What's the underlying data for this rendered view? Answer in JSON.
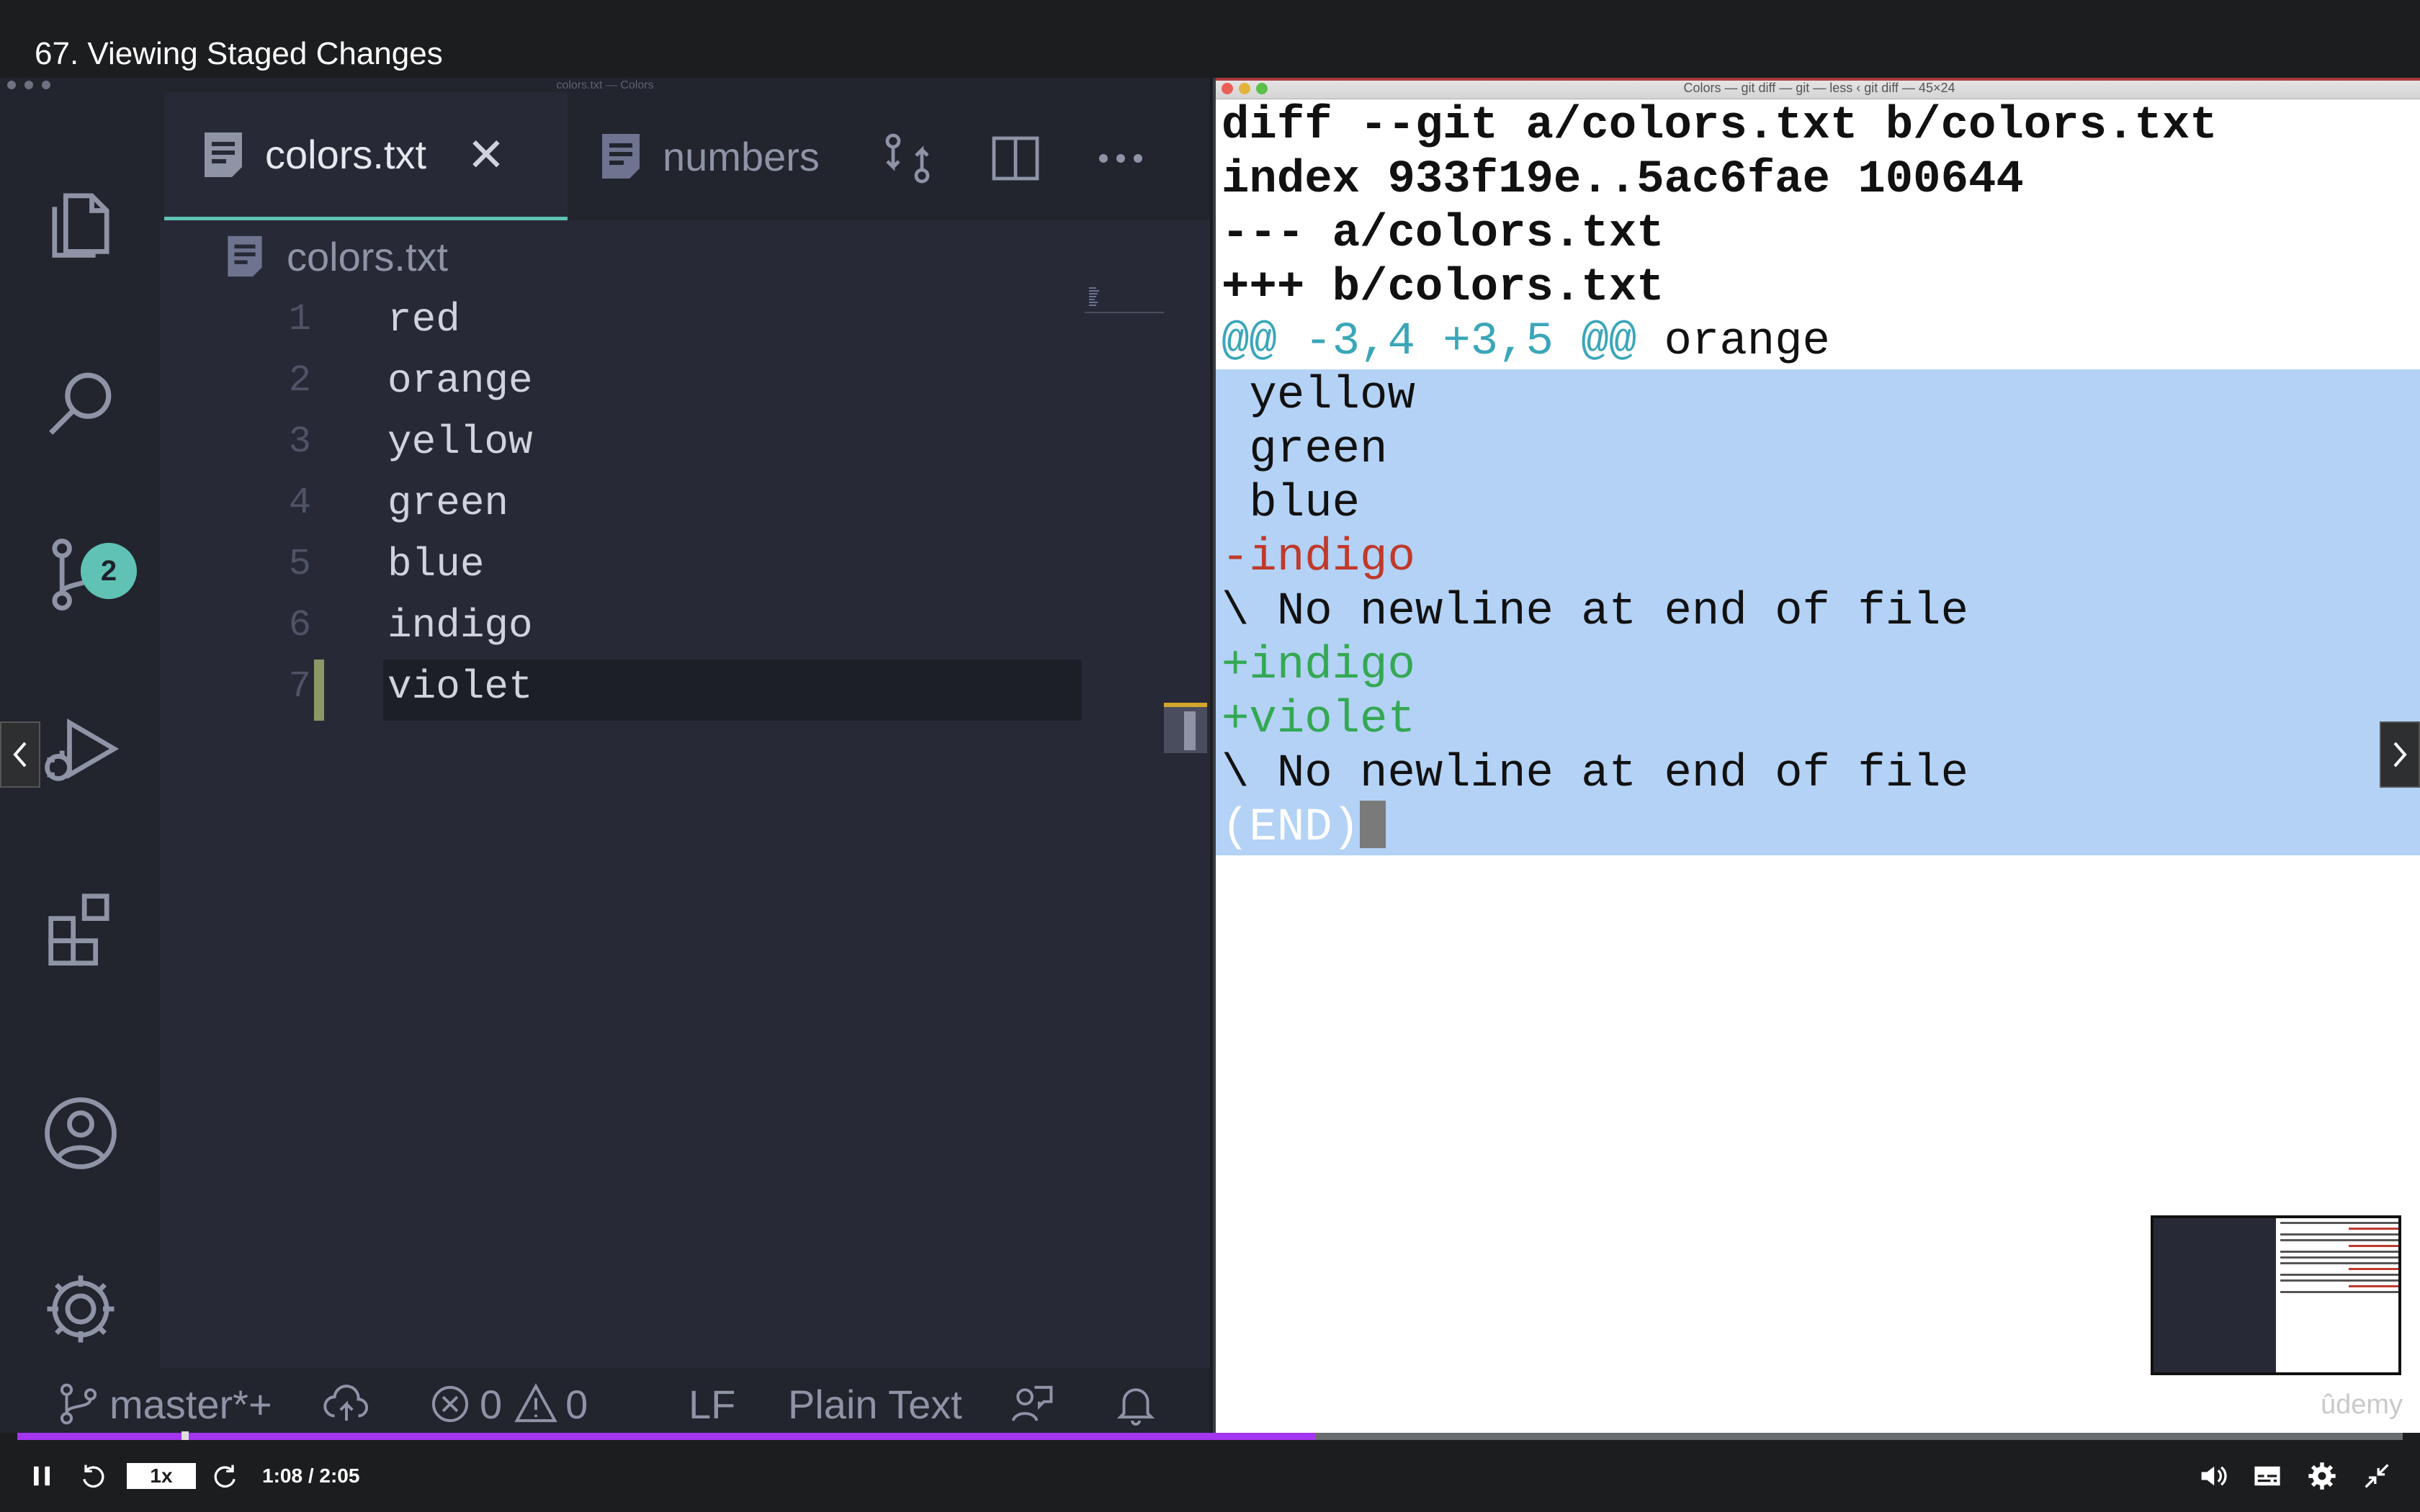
{
  "lecture": {
    "title": "67. Viewing Staged Changes"
  },
  "vscode": {
    "window_title": "colors.txt — Colors",
    "scm_badge": "2",
    "tabs": [
      {
        "label": "colors.txt",
        "active": true
      },
      {
        "label": "numbers",
        "active": false
      }
    ],
    "breadcrumb": "colors.txt",
    "lines": [
      {
        "num": "1",
        "text": "red"
      },
      {
        "num": "2",
        "text": "orange"
      },
      {
        "num": "3",
        "text": "yellow"
      },
      {
        "num": "4",
        "text": "green"
      },
      {
        "num": "5",
        "text": "blue"
      },
      {
        "num": "6",
        "text": "indigo"
      },
      {
        "num": "7",
        "text": "violet"
      }
    ],
    "status": {
      "branch": "master*+",
      "errors": "0",
      "warnings": "0",
      "eol": "LF",
      "language": "Plain Text"
    }
  },
  "terminal": {
    "window_title": "Colors — git diff — git — less ‹ git diff — 45×24",
    "lines": {
      "l1": "diff --git a/colors.txt b/colors.txt",
      "l2": "index 933f19e..5ac6fae 100644",
      "l3": "--- a/colors.txt",
      "l4": "+++ b/colors.txt",
      "l5_hunk": "@@ -3,4 +3,5 @@",
      "l5_ctx": " orange",
      "l6": " yellow",
      "l7": " green",
      "l8": " blue",
      "l9": "-indigo",
      "l10": "\\ No newline at end of file",
      "l11": "+indigo",
      "l12": "+violet",
      "l13": "\\ No newline at end of file",
      "l14": "(END)"
    }
  },
  "watermark": "ûdemy",
  "player": {
    "speed": "1x",
    "time": "1:08 / 2:05",
    "progress_fraction": 0.544
  },
  "colors": {
    "accent_teal": "#5fc2b5",
    "progress_purple": "#a435f0",
    "diff_cyan": "#3aa6b9",
    "diff_red": "#c0392b",
    "diff_green": "#34a853",
    "selection": "#b3d2f6"
  }
}
